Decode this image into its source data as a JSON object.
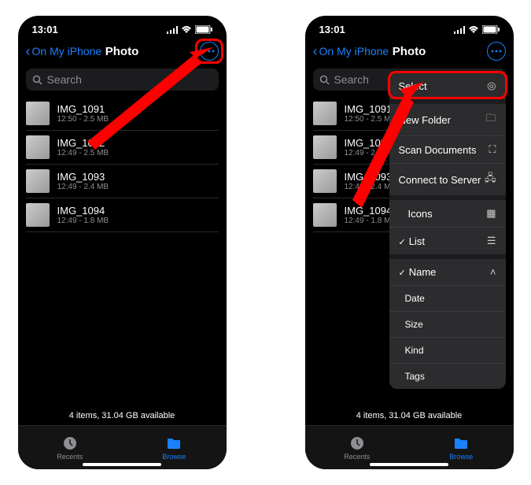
{
  "status": {
    "time": "13:01"
  },
  "nav": {
    "back": "On My iPhone",
    "title": "Photo"
  },
  "search": {
    "placeholder": "Search"
  },
  "files": [
    {
      "name": "IMG_1091",
      "meta": "12:50 - 2.5 MB"
    },
    {
      "name": "IMG_1092",
      "meta": "12:49 - 2.5 MB"
    },
    {
      "name": "IMG_1093",
      "meta": "12:49 - 2.4 MB"
    },
    {
      "name": "IMG_1094",
      "meta": "12:49 - 1.8 MB"
    }
  ],
  "footer": "4 items, 31.04 GB available",
  "tabs": {
    "recents": "Recents",
    "browse": "Browse"
  },
  "menu": {
    "select": "Select",
    "newFolder": "New Folder",
    "scan": "Scan Documents",
    "connect": "Connect to Server",
    "icons": "Icons",
    "list": "List",
    "name": "Name",
    "date": "Date",
    "size": "Size",
    "kind": "Kind",
    "tags": "Tags"
  }
}
